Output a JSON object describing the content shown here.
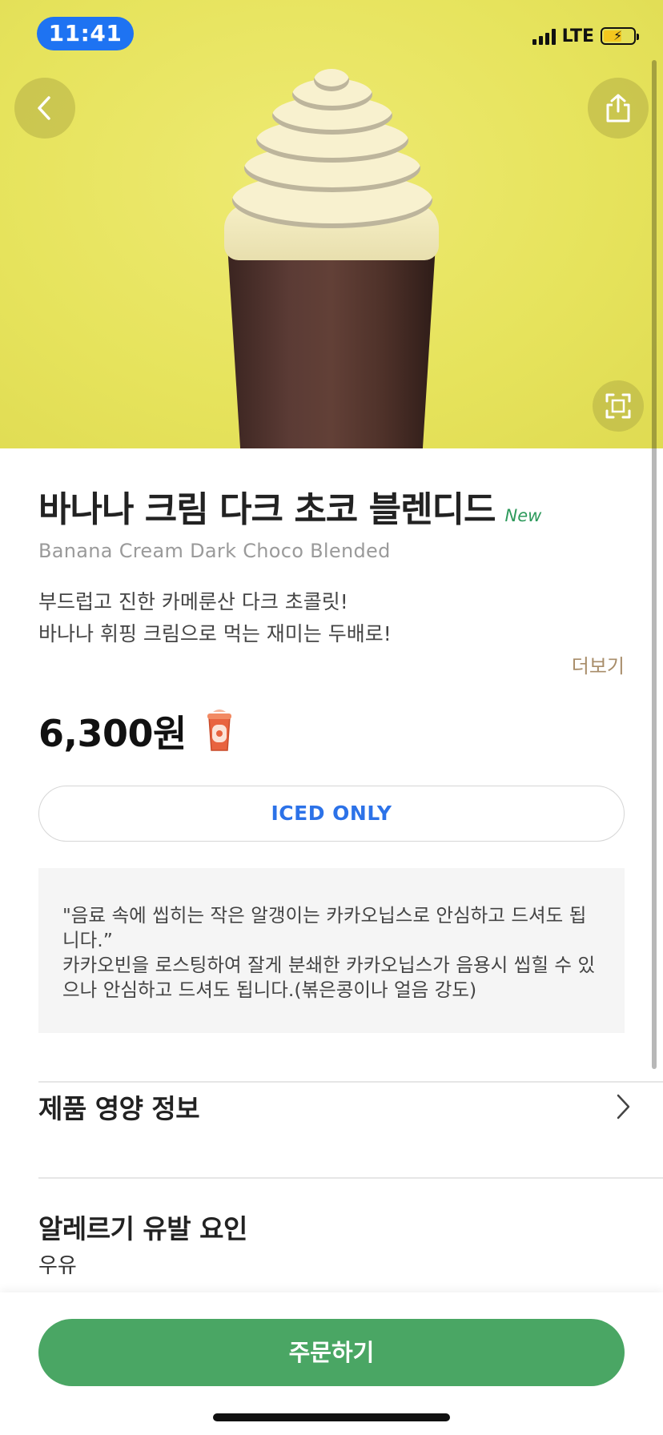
{
  "status_bar": {
    "time": "11:41",
    "network": "LTE"
  },
  "product": {
    "name_ko": "바나나 크림 다크 초코 블렌디드",
    "badge": "New",
    "name_en": "Banana Cream Dark Choco Blended",
    "description_lines": [
      "부드럽고 진한 카메룬산 다크 초콜릿!",
      "바나나 휘핑 크림으로 먹는 재미는 두배로!"
    ],
    "more_label": "더보기",
    "price": "6,300원",
    "temperature_option": "ICED ONLY"
  },
  "notice": {
    "line1": "\"음료 속에 씹히는 작은 알갱이는 카카오닙스로 안심하고 드셔도 됩니다.”",
    "line2": "카카오빈을 로스팅하여 잘게 분쇄한 카카오닙스가 음용시 씹힐 수 있으나 안심하고 드셔도 됩니다.(볶은콩이나 얼음 강도)"
  },
  "sections": {
    "nutrition_label": "제품 영양 정보",
    "allergy_title": "알레르기 유발 요인",
    "allergy_value": "우유"
  },
  "actions": {
    "order_label": "주문하기"
  },
  "icons": {
    "back": "chevron-left-icon",
    "share": "share-icon",
    "expand": "fullscreen-icon",
    "cup": "iced-cup-icon",
    "nutrition_chevron": "chevron-right-icon"
  },
  "colors": {
    "hero_bg": "#e6e35c",
    "accent_green": "#4aa664",
    "new_badge": "#2e9a5c",
    "iced_blue": "#2c72e8",
    "more_brown": "#a88d6a",
    "time_pill": "#1e73f2"
  }
}
